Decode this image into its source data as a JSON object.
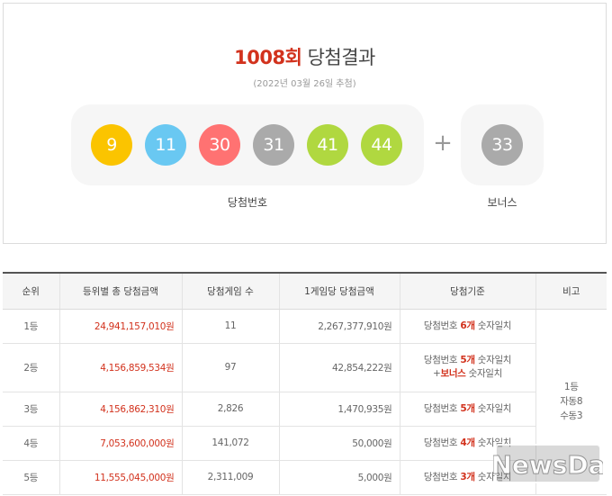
{
  "draw": {
    "round": "1008회",
    "title_suffix": "당첨결과",
    "date": "(2022년 03월 26일 추첨)",
    "numbers": [
      {
        "value": "9",
        "color": "#fbc400"
      },
      {
        "value": "11",
        "color": "#69c8f2"
      },
      {
        "value": "30",
        "color": "#ff7272"
      },
      {
        "value": "31",
        "color": "#aaaaaa"
      },
      {
        "value": "41",
        "color": "#b0d840"
      },
      {
        "value": "44",
        "color": "#b0d840"
      }
    ],
    "plus": "+",
    "bonus": {
      "value": "33",
      "color": "#aaaaaa"
    },
    "numbers_label": "당첨번호",
    "bonus_label": "보너스"
  },
  "table": {
    "headers": [
      "순위",
      "등위별 총 당첨금액",
      "당첨게임 수",
      "1게임당 당첨금액",
      "당첨기준",
      "비고"
    ],
    "rows": [
      {
        "rank": "1등",
        "total": "24,941,157,010원",
        "count": "11",
        "per": "2,267,377,910원",
        "crit_pre": "당첨번호 ",
        "crit_num": "6개",
        "crit_post": " 숫자일치",
        "crit2_pre": "",
        "crit2_num": "",
        "crit2_post": ""
      },
      {
        "rank": "2등",
        "total": "4,156,859,534원",
        "count": "97",
        "per": "42,854,222원",
        "crit_pre": "당첨번호 ",
        "crit_num": "5개",
        "crit_post": " 숫자일치",
        "crit2_pre": "+",
        "crit2_num": "보너스",
        "crit2_post": " 숫자일치"
      },
      {
        "rank": "3등",
        "total": "4,156,862,310원",
        "count": "2,826",
        "per": "1,470,935원",
        "crit_pre": "당첨번호 ",
        "crit_num": "5개",
        "crit_post": " 숫자일치",
        "crit2_pre": "",
        "crit2_num": "",
        "crit2_post": ""
      },
      {
        "rank": "4등",
        "total": "7,053,600,000원",
        "count": "141,072",
        "per": "50,000원",
        "crit_pre": "당첨번호 ",
        "crit_num": "4개",
        "crit_post": " 숫자일치",
        "crit2_pre": "",
        "crit2_num": "",
        "crit2_post": ""
      },
      {
        "rank": "5등",
        "total": "11,555,045,000원",
        "count": "2,311,009",
        "per": "5,000원",
        "crit_pre": "당첨번호 ",
        "crit_num": "3개",
        "crit_post": " 숫자일치",
        "crit2_pre": "",
        "crit2_num": "",
        "crit2_post": ""
      }
    ],
    "note": [
      "1등",
      "자동8",
      "수동3"
    ]
  },
  "watermark": "NewsDa",
  "colors": {
    "accent_red": "#d2321d",
    "panel_bg": "#f6f6f6",
    "header_bg": "#f5f5f5"
  }
}
